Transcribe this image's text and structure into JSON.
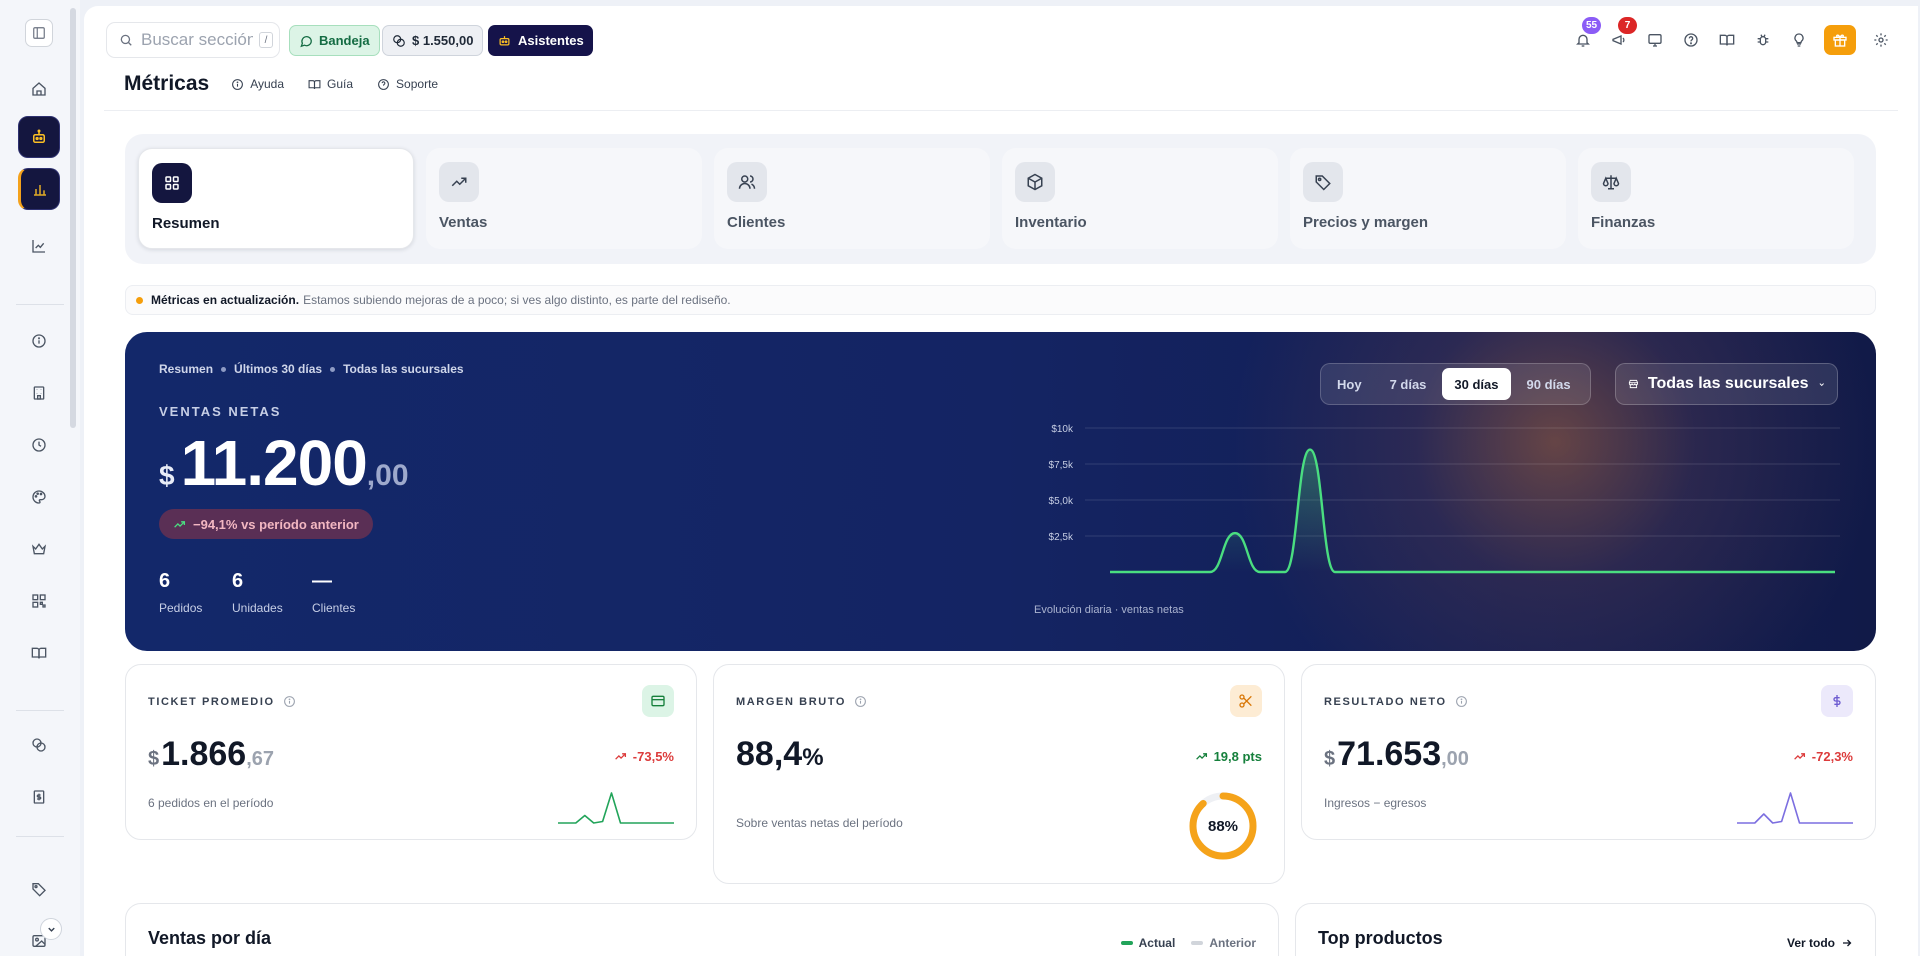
{
  "topbar": {
    "search_placeholder": "Buscar sección...",
    "search_shortcut": "/",
    "inbox_label": "Bandeja",
    "balance_label": "$ 1.550,00",
    "assistants_label": "Asistentes",
    "notifications_count": "55",
    "alerts_count": "7"
  },
  "page": {
    "title": "Métricas",
    "help_links": [
      "Ayuda",
      "Guía",
      "Soporte"
    ]
  },
  "tabs": [
    {
      "label": "Resumen",
      "icon": "grid-icon",
      "active": true
    },
    {
      "label": "Ventas",
      "icon": "trending-up-icon",
      "active": false
    },
    {
      "label": "Clientes",
      "icon": "users-icon",
      "active": false
    },
    {
      "label": "Inventario",
      "icon": "box-icon",
      "active": false
    },
    {
      "label": "Precios y margen",
      "icon": "tag-icon",
      "active": false
    },
    {
      "label": "Finanzas",
      "icon": "scale-icon",
      "active": false
    }
  ],
  "notice": {
    "bold": "Métricas en actualización.",
    "text": "Estamos subiendo mejoras de a poco; si ves algo distinto, es parte del rediseño."
  },
  "hero": {
    "crumbs": [
      "Resumen",
      "Últimos 30 días",
      "Todas las sucursales"
    ],
    "kpi_label": "VENTAS NETAS",
    "currency": "$",
    "value_int": "11.200",
    "value_dec": ",00",
    "delta": "−94,1% vs período anterior",
    "stats": [
      {
        "value": "6",
        "label": "Pedidos"
      },
      {
        "value": "6",
        "label": "Unidades"
      },
      {
        "value": "—",
        "label": "Clientes"
      }
    ],
    "ranges": [
      "Hoy",
      "7 días",
      "30 días",
      "90 días"
    ],
    "selected_range": "30 días",
    "branch_label": "Todas las sucursales",
    "chart_caption": "Evolución diaria · ventas netas"
  },
  "chart_data": {
    "type": "area",
    "title": "",
    "xlabel": "",
    "ylabel": "",
    "y_ticks": [
      "$10k",
      "$7,5k",
      "$5,0k",
      "$2,5k"
    ],
    "ylim": [
      0,
      10000
    ],
    "x": [
      1,
      2,
      3,
      4,
      5,
      6,
      7,
      8,
      9,
      10,
      11,
      12,
      13,
      14,
      15,
      16,
      17,
      18,
      19,
      20,
      21,
      22,
      23,
      24,
      25,
      26,
      27,
      28,
      29,
      30
    ],
    "series": [
      {
        "values": [
          0,
          0,
          0,
          0,
          0,
          2700,
          0,
          0,
          8500,
          0,
          0,
          0,
          0,
          0,
          0,
          0,
          0,
          0,
          0,
          0,
          0,
          0,
          0,
          0,
          0,
          0,
          0,
          0,
          0,
          0
        ]
      }
    ],
    "line_color": "#4ade80",
    "grid": true
  },
  "cards": {
    "ticket": {
      "label": "TICKET PROMEDIO",
      "currency": "$",
      "int": "1.866",
      "dec": ",67",
      "delta": "-73,5%",
      "sub": "6 pedidos en el período",
      "spark": [
        0,
        0,
        0,
        0.25,
        0,
        0.05,
        1,
        0,
        0,
        0,
        0,
        0,
        0,
        0
      ],
      "color": "#22a45a"
    },
    "margin": {
      "label": "MARGEN BRUTO",
      "int": "88,4",
      "suffix": "%",
      "delta": "19,8 pts",
      "sub": "Sobre ventas netas del período",
      "donut_label": "88%",
      "donut_fraction": 0.884,
      "color": "#f5a31a"
    },
    "result": {
      "label": "RESULTADO NETO",
      "currency": "$",
      "int": "71.653",
      "dec": ",00",
      "delta": "-72,3%",
      "sub": "Ingresos − egresos",
      "spark": [
        0,
        0,
        0,
        0.3,
        0,
        0.05,
        1,
        0,
        0,
        0,
        0,
        0,
        0,
        0
      ],
      "color": "#7c6fe0"
    }
  },
  "bottom": {
    "sales_title": "Ventas por día",
    "legend_current": "Actual",
    "legend_previous": "Anterior",
    "top_title": "Top productos",
    "see_all": "Ver todo"
  }
}
